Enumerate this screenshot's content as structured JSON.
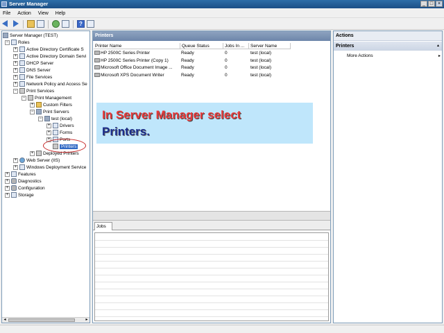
{
  "window": {
    "title": "Server Manager"
  },
  "menu": [
    "File",
    "Action",
    "View",
    "Help"
  ],
  "tree": [
    {
      "label": "Server Manager (TEST)",
      "icon": "server-icon",
      "level": 0,
      "expander": ""
    },
    {
      "label": "Roles",
      "icon": "roles-icon",
      "level": 1,
      "expander": "−"
    },
    {
      "label": "Active Directory Certificate S",
      "icon": "role-icon",
      "level": 2,
      "expander": "+"
    },
    {
      "label": "Active Directory Domain Servi",
      "icon": "role-icon",
      "level": 2,
      "expander": "+"
    },
    {
      "label": "DHCP Server",
      "icon": "role-icon",
      "level": 2,
      "expander": "+"
    },
    {
      "label": "DNS Server",
      "icon": "role-icon",
      "level": 2,
      "expander": "+"
    },
    {
      "label": "File Services",
      "icon": "role-icon",
      "level": 2,
      "expander": "+"
    },
    {
      "label": "Network Policy and Access Se",
      "icon": "role-icon",
      "level": 2,
      "expander": "+"
    },
    {
      "label": "Print Services",
      "icon": "printer-icon",
      "level": 2,
      "expander": "−"
    },
    {
      "label": "Print Management",
      "icon": "printer-icon",
      "level": 3,
      "expander": "−"
    },
    {
      "label": "Custom Filters",
      "icon": "folder-icon",
      "level": 4,
      "expander": "+"
    },
    {
      "label": "Print Servers",
      "icon": "server-icon",
      "level": 4,
      "expander": "−"
    },
    {
      "label": "test (local)",
      "icon": "server-icon",
      "level": 5,
      "expander": "−"
    },
    {
      "label": "Drivers",
      "icon": "drivers-icon",
      "level": 6,
      "expander": "+"
    },
    {
      "label": "Forms",
      "icon": "forms-icon",
      "level": 6,
      "expander": "+"
    },
    {
      "label": "Ports",
      "icon": "ports-icon",
      "level": 6,
      "expander": "+"
    },
    {
      "label": "Printers",
      "icon": "printer-icon",
      "level": 6,
      "expander": "",
      "selected": true
    },
    {
      "label": "Deployed Printers",
      "icon": "printer-icon",
      "level": 4,
      "expander": "+"
    },
    {
      "label": "Web Server (IIS)",
      "icon": "globe-icon",
      "level": 2,
      "expander": "+"
    },
    {
      "label": "Windows Deployment Service",
      "icon": "role-icon",
      "level": 2,
      "expander": "+"
    },
    {
      "label": "Features",
      "icon": "features-icon",
      "level": 1,
      "expander": "+"
    },
    {
      "label": "Diagnostics",
      "icon": "diagnostics-icon",
      "level": 1,
      "expander": "+"
    },
    {
      "label": "Configuration",
      "icon": "configuration-icon",
      "level": 1,
      "expander": "+"
    },
    {
      "label": "Storage",
      "icon": "storage-icon",
      "level": 1,
      "expander": "+"
    }
  ],
  "printers_pane": {
    "header": "Printers",
    "columns": [
      "Printer Name",
      "Queue Status",
      "Jobs In ...",
      "Server Name"
    ],
    "rows": [
      [
        "HP 2500C Series Printer",
        "Ready",
        "0",
        "test (local)"
      ],
      [
        "HP 2500C Series Printer (Copy 1)",
        "Ready",
        "0",
        "test (local)"
      ],
      [
        "Microsoft Office Document Image ...",
        "Ready",
        "0",
        "test (local)"
      ],
      [
        "Microsoft XPS Document Writer",
        "Ready",
        "0",
        "test (local)"
      ]
    ]
  },
  "callout": {
    "line1": "In Server Manager select",
    "line2": "Printers."
  },
  "jobs": {
    "tab_label": "Jobs"
  },
  "actions": {
    "header": "Actions",
    "section": "Printers",
    "items": [
      "More Actions"
    ]
  },
  "colors": {
    "selection": "#316ac5",
    "callout_bg": "#bfe6fb",
    "callout_red": "#e83a3a",
    "callout_blue": "#1b2d8a"
  }
}
